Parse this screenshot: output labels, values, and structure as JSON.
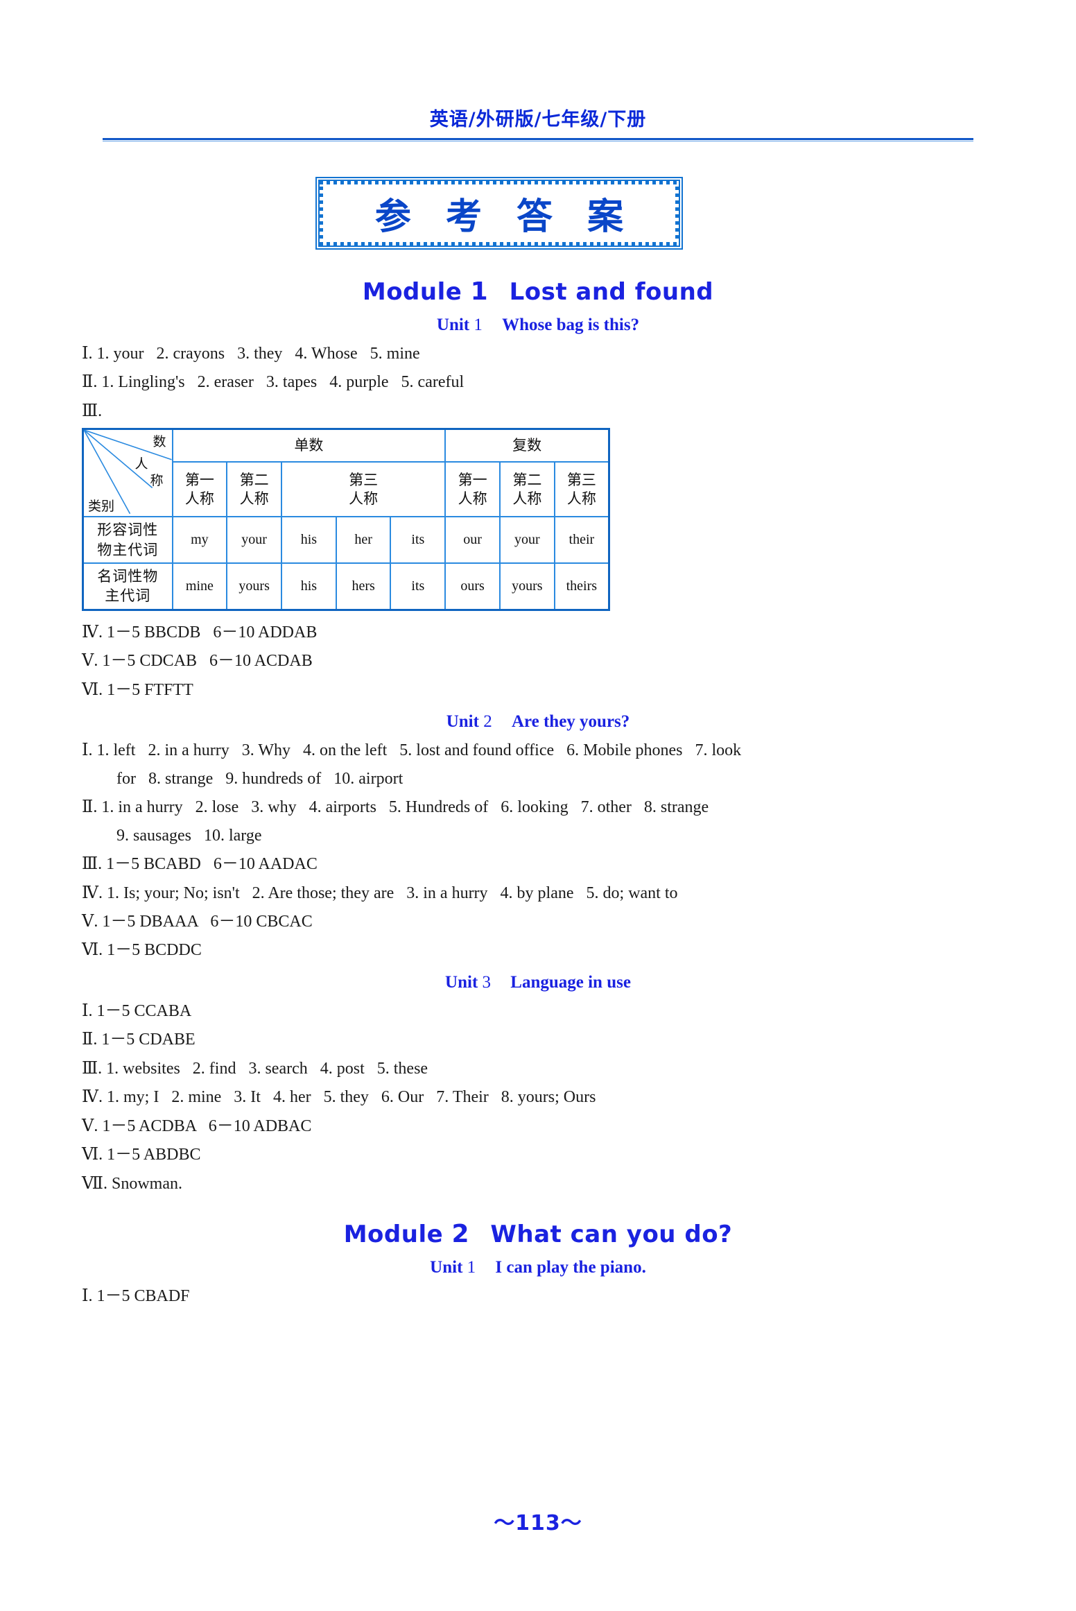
{
  "header": {
    "title": "英语/外研版/七年级/下册"
  },
  "answer_title": "参 考 答 案",
  "colors": {
    "accent_blue": "#1a22e0",
    "rule_blue": "#1258c8",
    "box_blue": "#1273d1",
    "table_border": "#2a8ae0"
  },
  "modules": [
    {
      "number": "1",
      "title": "Lost and found",
      "units": [
        {
          "number": "1",
          "title": "Whose bag is this?",
          "lines": [
            {
              "roman": "Ⅰ",
              "text": ". 1. your   2. crayons   3. they   4. Whose   5. mine"
            },
            {
              "roman": "Ⅱ",
              "text": ". 1. Lingling's   2. eraser   3. tapes   4. purple   5. careful"
            },
            {
              "roman": "Ⅲ",
              "text": "."
            }
          ],
          "table": {
            "diagonal": {
              "top": "数",
              "mid": "人",
              "mid2": "称",
              "bottom": "类别"
            },
            "group_headers": [
              "单数",
              "复数"
            ],
            "person_headers": [
              "第一\n人称",
              "第二\n人称",
              "第三\n人称",
              "第一\n人称",
              "第二\n人称",
              "第三\n人称"
            ],
            "rows": [
              {
                "label": "形容词性\n物主代词",
                "cells": [
                  "my",
                  "your",
                  "his",
                  "her",
                  "its",
                  "our",
                  "your",
                  "their"
                ]
              },
              {
                "label": "名词性物\n主代词",
                "cells": [
                  "mine",
                  "yours",
                  "his",
                  "hers",
                  "its",
                  "ours",
                  "yours",
                  "theirs"
                ]
              }
            ]
          },
          "lines_after": [
            {
              "roman": "Ⅳ",
              "text": ". 1－5 BBCDB   6－10 ADDAB"
            },
            {
              "roman": "Ⅴ",
              "text": ". 1－5 CDCAB   6－10 ACDAB"
            },
            {
              "roman": "Ⅵ",
              "text": ". 1－5 FTFTT"
            }
          ]
        },
        {
          "number": "2",
          "title": "Are they yours?",
          "lines": [
            {
              "roman": "Ⅰ",
              "text": ". 1. left   2. in a hurry   3. Why   4. on the left   5. lost and found office   6. Mobile phones   7. look"
            },
            {
              "roman": "",
              "text": "for   8. strange   9. hundreds of   10. airport",
              "cont": true
            },
            {
              "roman": "Ⅱ",
              "text": ". 1. in a hurry   2. lose   3. why   4. airports   5. Hundreds of   6. looking   7. other   8. strange"
            },
            {
              "roman": "",
              "text": "9. sausages   10. large",
              "cont": true
            },
            {
              "roman": "Ⅲ",
              "text": ". 1－5 BCABD   6－10 AADAC"
            },
            {
              "roman": "Ⅳ",
              "text": ". 1. Is; your; No; isn't   2. Are those; they are   3. in a hurry   4. by plane   5. do; want to"
            },
            {
              "roman": "Ⅴ",
              "text": ". 1－5 DBAAA   6－10 CBCAC"
            },
            {
              "roman": "Ⅵ",
              "text": ". 1－5 BCDDC"
            }
          ]
        },
        {
          "number": "3",
          "title": "Language in use",
          "lines": [
            {
              "roman": "Ⅰ",
              "text": ". 1－5 CCABA"
            },
            {
              "roman": "Ⅱ",
              "text": ". 1－5 CDABE"
            },
            {
              "roman": "Ⅲ",
              "text": ". 1. websites   2. find   3. search   4. post   5. these"
            },
            {
              "roman": "Ⅳ",
              "text": ". 1. my; I   2. mine   3. It   4. her   5. they   6. Our   7. Their   8. yours; Ours"
            },
            {
              "roman": "Ⅴ",
              "text": ". 1－5 ACDBA   6－10 ADBAC"
            },
            {
              "roman": "Ⅵ",
              "text": ". 1－5 ABDBC"
            },
            {
              "roman": "Ⅶ",
              "text": ". Snowman."
            }
          ]
        }
      ]
    },
    {
      "number": "2",
      "title": "What can you do?",
      "units": [
        {
          "number": "1",
          "title": "I can play the piano.",
          "lines": [
            {
              "roman": "Ⅰ",
              "text": ". 1－5 CBADF"
            }
          ]
        }
      ]
    }
  ],
  "page_number": "～113～"
}
